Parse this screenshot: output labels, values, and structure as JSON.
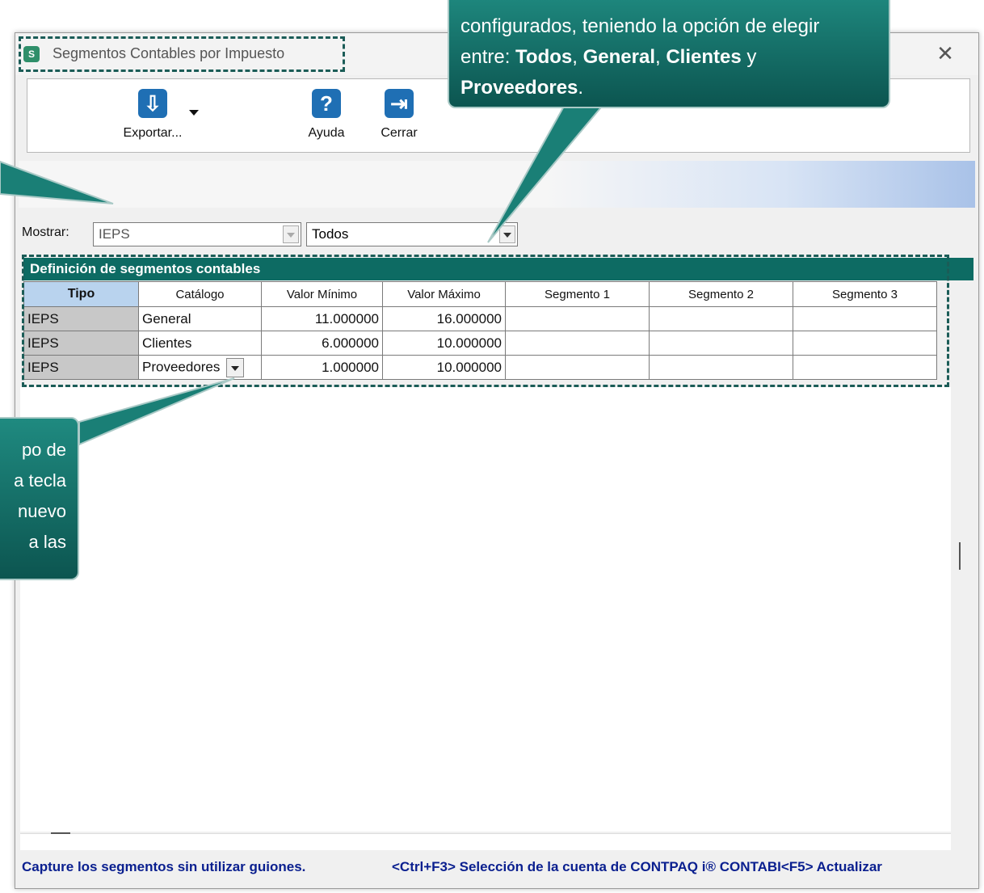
{
  "window": {
    "title": "Segmentos Contables por Impuesto",
    "app_icon_letter": "S"
  },
  "toolbar": {
    "export_label": "Exportar...",
    "help_label": "Ayuda",
    "close_label": "Cerrar"
  },
  "filter": {
    "label": "Mostrar:",
    "tax_value": "IEPS",
    "catalog_value": "Todos"
  },
  "grid": {
    "title": "Definición de segmentos contables",
    "columns": [
      "Tipo",
      "Catálogo",
      "Valor Mínimo",
      "Valor Máximo",
      "Segmento 1",
      "Segmento 2",
      "Segmento 3"
    ],
    "rows": [
      {
        "tipo": "IEPS",
        "catalogo": "General",
        "min": "11.000000",
        "max": "16.000000",
        "s1": "",
        "s2": "",
        "s3": ""
      },
      {
        "tipo": "IEPS",
        "catalogo": "Clientes",
        "min": "6.000000",
        "max": "10.000000",
        "s1": "",
        "s2": "",
        "s3": ""
      },
      {
        "tipo": "IEPS",
        "catalogo": "Proveedores",
        "min": "1.000000",
        "max": "10.000000",
        "s1": "",
        "s2": "",
        "s3": ""
      }
    ]
  },
  "status": {
    "left": "Capture los segmentos sin utilizar guiones.",
    "right": "<Ctrl+F3> Selección de la cuenta de CONTPAQ i® CONTABI<F5> Actualizar"
  },
  "callout_top": {
    "line1": "configurados, teniendo la opción de elegir",
    "line2_prefix": "entre:",
    "opt1": "Todos",
    "opt2": "General",
    "opt3": "Clientes",
    "conj": "y",
    "opt4": "Proveedores",
    "end": "."
  },
  "callout_left": {
    "lines": [
      "po de",
      "a tecla",
      "nuevo",
      "a las"
    ]
  },
  "colors": {
    "accent_teal": "#0d6b63",
    "status_blue": "#0a1f8f",
    "header_blue": "#b9d3ee",
    "toolbar_icon_blue": "#1f6fb4"
  }
}
